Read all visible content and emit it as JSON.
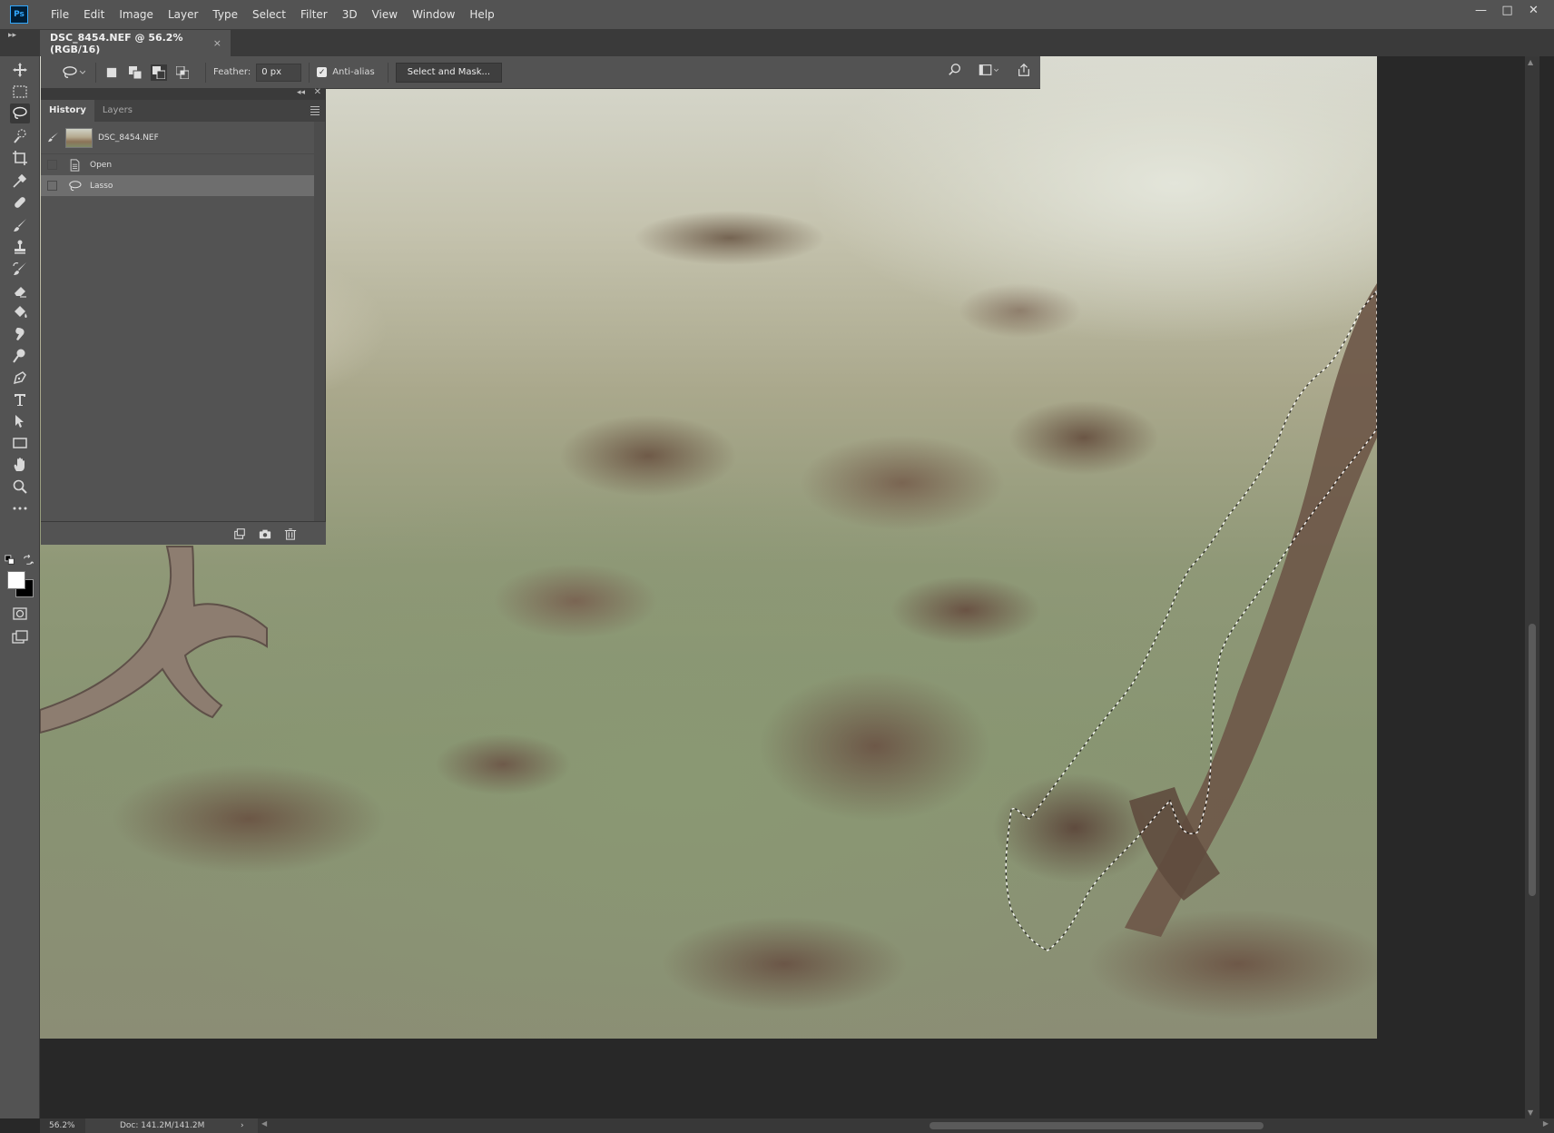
{
  "app": {
    "logo": "Ps"
  },
  "menu": [
    "File",
    "Edit",
    "Image",
    "Layer",
    "Type",
    "Select",
    "Filter",
    "3D",
    "View",
    "Window",
    "Help"
  ],
  "window_controls": {
    "minimize": "—",
    "restore": "□",
    "close": "✕"
  },
  "document_tab": {
    "title": "DSC_8454.NEF @ 56.2% (RGB/16)",
    "close": "×"
  },
  "options_bar": {
    "feather_label": "Feather:",
    "feather_value": "0 px",
    "antialias_label": "Anti-alias",
    "antialias_checked": true,
    "select_and_mask": "Select and Mask..."
  },
  "history_panel": {
    "tabs": [
      "History",
      "Layers"
    ],
    "active_tab": "History",
    "snapshot_name": "DSC_8454.NEF",
    "states": [
      {
        "label": "Open",
        "icon": "document-icon",
        "selected": false
      },
      {
        "label": "Lasso",
        "icon": "lasso-icon",
        "selected": true
      }
    ]
  },
  "status_bar": {
    "zoom": "56.2%",
    "doc_info": "Doc: 141.2M/141.2M",
    "arrow": "›"
  },
  "tools": [
    "move-tool-icon",
    "marquee-tool-icon",
    "lasso-tool-icon",
    "quick-selection-tool-icon",
    "crop-tool-icon",
    "eyedropper-tool-icon",
    "healing-brush-tool-icon",
    "brush-tool-icon",
    "clone-stamp-tool-icon",
    "history-brush-tool-icon",
    "eraser-tool-icon",
    "paint-bucket-tool-icon",
    "smudge-tool-icon",
    "dodge-tool-icon",
    "pen-tool-icon",
    "type-tool-icon",
    "path-selection-tool-icon",
    "rectangle-tool-icon",
    "hand-tool-icon",
    "zoom-tool-icon",
    "more-tools-icon"
  ],
  "colors": {
    "ui_dark": "#282828",
    "ui_panel": "#535353",
    "ui_light": "#424242",
    "accent": "#31a8ff"
  }
}
